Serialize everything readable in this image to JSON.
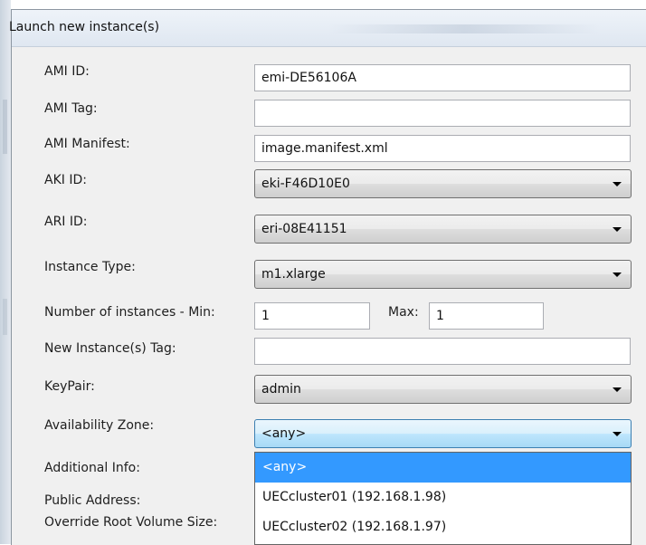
{
  "dialog": {
    "title": "Launch new instance(s)"
  },
  "form": {
    "ami_id": {
      "label": "AMI ID:",
      "value": "emi-DE56106A"
    },
    "ami_tag": {
      "label": "AMI Tag:",
      "value": ""
    },
    "ami_manifest": {
      "label": "AMI Manifest:",
      "value": "image.manifest.xml"
    },
    "aki_id": {
      "label": "AKI ID:",
      "value": "eki-F46D10E0"
    },
    "ari_id": {
      "label": "ARI ID:",
      "value": "eri-08E41151"
    },
    "instance_type": {
      "label": "Instance Type:",
      "value": "m1.xlarge"
    },
    "num_instances": {
      "label": "Number of instances - Min:",
      "min_value": "1",
      "max_label": "Max:",
      "max_value": "1"
    },
    "new_instance_tag": {
      "label": "New Instance(s) Tag:",
      "value": ""
    },
    "keypair": {
      "label": "KeyPair:",
      "value": "admin"
    },
    "availability_zone": {
      "label": "Availability Zone:",
      "value": "<any>",
      "options": [
        "<any>",
        "UECcluster01 (192.168.1.98)",
        "UECcluster02 (192.168.1.97)"
      ]
    },
    "additional_info": {
      "label": "Additional Info:"
    },
    "public_address": {
      "label": "Public Address:"
    },
    "override_root": {
      "label": "Override Root Volume Size:"
    }
  },
  "colors": {
    "selection": "#3399ff",
    "focus_border": "#3c7fb1"
  }
}
